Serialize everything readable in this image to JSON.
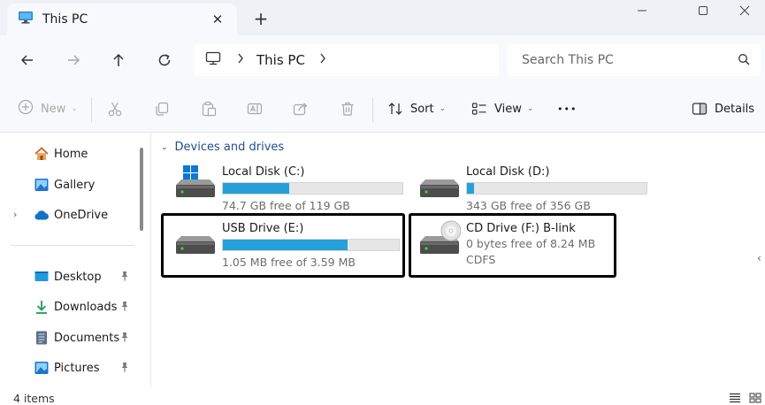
{
  "window": {
    "tab_title": "This PC",
    "close_tab_glyph": "✕",
    "new_tab_glyph": "+"
  },
  "navigation": {
    "breadcrumb": [
      "This PC"
    ],
    "search_placeholder": "Search This PC"
  },
  "command_bar": {
    "new_label": "New",
    "sort_label": "Sort",
    "view_label": "View",
    "more_glyph": "•••",
    "details_label": "Details"
  },
  "sidebar": {
    "home": "Home",
    "gallery": "Gallery",
    "onedrive": "OneDrive",
    "desktop": "Desktop",
    "downloads": "Downloads",
    "documents": "Documents",
    "pictures": "Pictures"
  },
  "content": {
    "section_title": "Devices and drives",
    "drives": [
      {
        "name": "Local Disk (C:)",
        "free_text": "74.7 GB free of 119 GB",
        "used_fraction": 0.37
      },
      {
        "name": "Local Disk (D:)",
        "free_text": "343 GB free of 356 GB",
        "used_fraction": 0.04
      },
      {
        "name": "USB Drive (E:)",
        "free_text": "1.05 MB free of 3.59 MB",
        "used_fraction": 0.71
      },
      {
        "name": "CD Drive (F:) B-link",
        "free_text": "0 bytes free of 8.24 MB",
        "filesystem": "CDFS"
      }
    ]
  },
  "status": {
    "item_count": "4 items"
  },
  "colors": {
    "accent": "#26a0da",
    "highlight_border": "#000000",
    "section_title": "#1f4e8c"
  }
}
